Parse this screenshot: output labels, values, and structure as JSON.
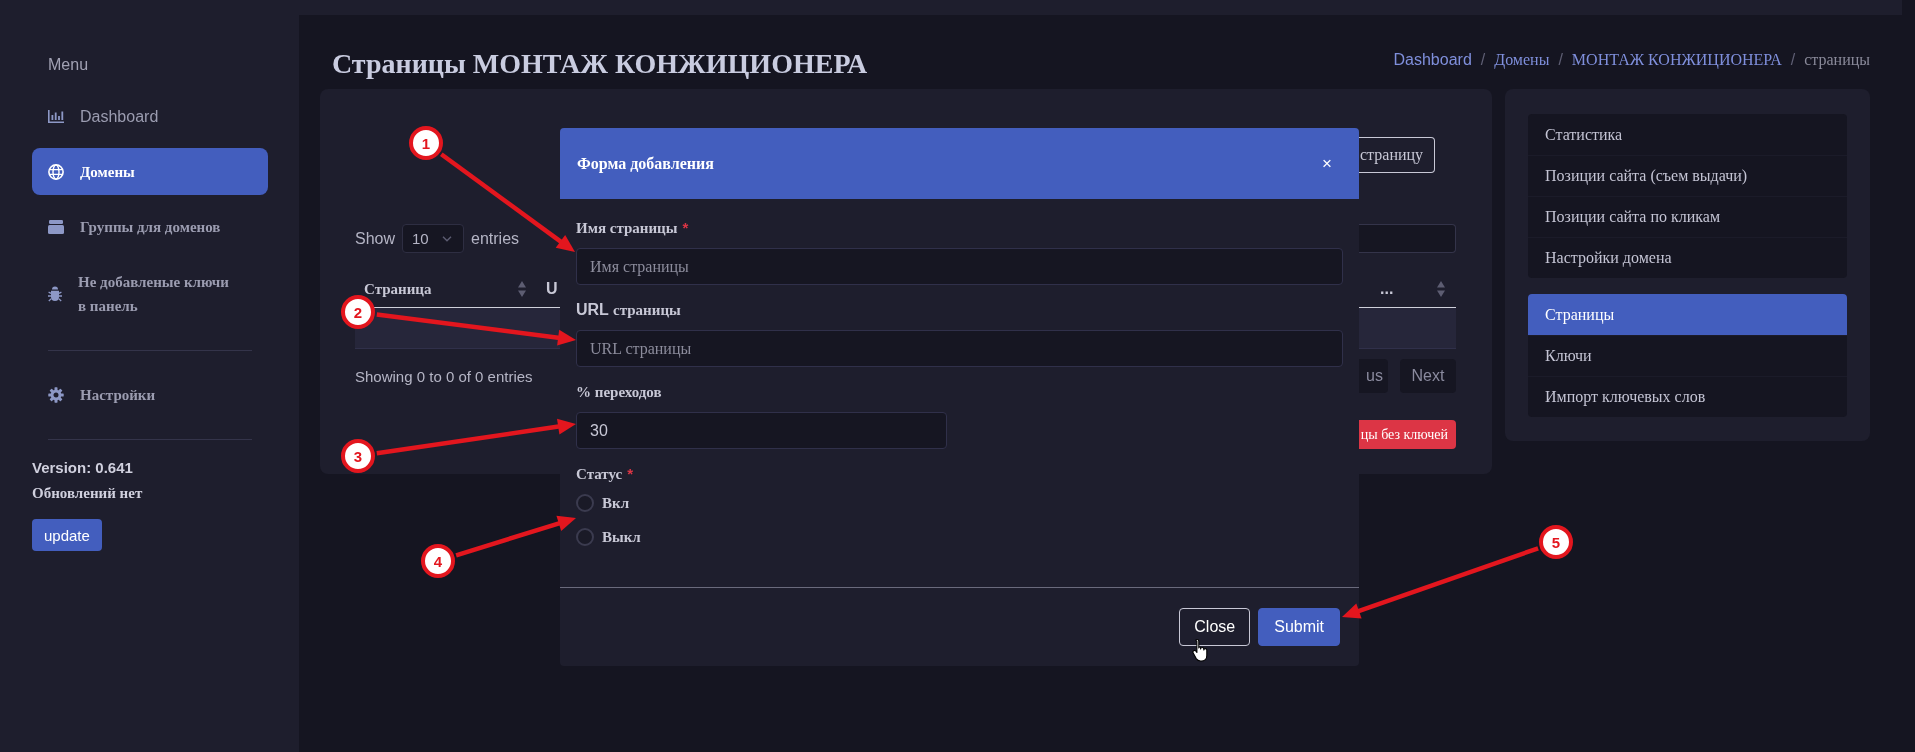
{
  "sidebar": {
    "heading": "Menu",
    "groups": [
      {
        "items": [
          {
            "label": "Dashboard",
            "selected": false
          },
          {
            "label": "Домены",
            "selected": true
          },
          {
            "label": "Группы для доменов",
            "selected": false
          },
          {
            "label": "Не добавленые ключи в панель",
            "selected": false
          }
        ]
      },
      {
        "items": [
          {
            "label": "Настройки",
            "selected": false
          }
        ]
      }
    ],
    "version": "Version: 0.641",
    "update_status": "Обновлений нет",
    "update_button": "update"
  },
  "header": {
    "title": "Страницы МОНТАЖ КОНЖИЦИОНЕРА",
    "breadcrumb": [
      {
        "kind": "link",
        "label": "Dashboard"
      },
      {
        "kind": "separator",
        "label": "/"
      },
      {
        "kind": "link",
        "label": "Домены"
      },
      {
        "kind": "separator",
        "label": "/"
      },
      {
        "kind": "link",
        "label": "МОНТАЖ КОНЖИЦИОНЕРА"
      },
      {
        "kind": "separator",
        "label": "/"
      },
      {
        "kind": "current",
        "label": "страницы"
      }
    ]
  },
  "pages_card": {
    "add_button": "страницу",
    "length_menu": {
      "prefix": "Show",
      "value": "10",
      "suffix": "entries"
    },
    "columns": [
      "Страница",
      "U",
      "..."
    ],
    "info": "Showing 0 to 0 of 0 entries",
    "pagination": [
      "us",
      "Next"
    ],
    "danger_button": "цы без ключей"
  },
  "domain_menu": {
    "groups": [
      {
        "items": [
          {
            "label": "Статистика",
            "selected": false
          },
          {
            "label": "Позиции сайта (съем выдачи)",
            "selected": false
          },
          {
            "label": "Позиции сайта по кликам",
            "selected": false
          },
          {
            "label": "Настройки домена",
            "selected": false
          }
        ]
      },
      {
        "items": [
          {
            "label": "Страницы",
            "selected": true
          },
          {
            "label": "Ключи",
            "selected": false
          },
          {
            "label": "Импорт ключевых слов",
            "selected": false
          }
        ]
      }
    ]
  },
  "modal": {
    "title": "Форма добавления",
    "close_button": "×",
    "fields": [
      {
        "kind": "text",
        "label": "Имя страницы",
        "required_mark": "*",
        "placeholder": "Имя страницы"
      },
      {
        "kind": "text",
        "label": "URL страницы",
        "placeholder": "URL страницы"
      },
      {
        "kind": "number",
        "label": "% переходов",
        "value": "30"
      },
      {
        "kind": "radio",
        "label": "Статус",
        "required_mark": "*",
        "options": [
          {
            "label": "Вкл",
            "selected": false
          },
          {
            "label": "Выкл",
            "selected": false
          }
        ]
      }
    ],
    "buttons": [
      {
        "kind": "secondary",
        "label": "Close"
      },
      {
        "kind": "primary",
        "label": "Submit"
      }
    ]
  },
  "annotations": [
    {
      "label": "1"
    },
    {
      "label": "2"
    },
    {
      "label": "3"
    },
    {
      "label": "4"
    },
    {
      "label": "5"
    }
  ]
}
